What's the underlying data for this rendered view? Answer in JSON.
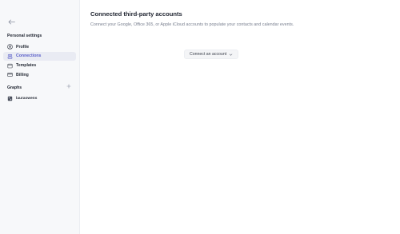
{
  "sidebar": {
    "back_icon": "arrow-left-icon",
    "settings_section_label": "Personal settings",
    "items": [
      {
        "label": "Profile",
        "icon": "user-circle-icon",
        "active": false
      },
      {
        "label": "Connections",
        "icon": "link-people-icon",
        "active": true
      },
      {
        "label": "Templates",
        "icon": "template-icon",
        "active": false
      },
      {
        "label": "Billing",
        "icon": "credit-card-icon",
        "active": false
      }
    ],
    "graphs_section_label": "Graphs",
    "add_graph_icon": "plus-icon",
    "graphs": [
      {
        "label": "lauraowens",
        "icon": "graph-icon"
      }
    ]
  },
  "main": {
    "title": "Connected third-party accounts",
    "subtitle": "Connect your Google, Office 365, or Apple iCloud accounts to populate your contacts and calendar events.",
    "connect_button_label": "Connect an account",
    "connect_button_icon": "chevron-down-icon"
  },
  "colors": {
    "accent": "#5a5fc9",
    "active_bg": "#e9ebf3",
    "sidebar_bg": "#f7f8fa"
  }
}
